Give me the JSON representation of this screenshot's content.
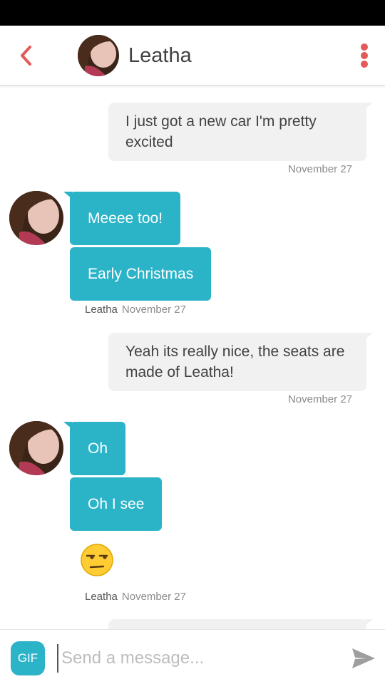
{
  "header": {
    "name": "Leatha",
    "back_icon": "chevron-left-icon",
    "menu_icon": "more-vertical-icon",
    "accent": "#e35a5a"
  },
  "messages": [
    {
      "from": "me",
      "text": "I just got a new car I'm pretty excited",
      "time": "November 27"
    },
    {
      "from": "them",
      "sender": "Leatha",
      "bubbles": [
        "Meeee too!",
        "Early Christmas"
      ],
      "time": "November 27"
    },
    {
      "from": "me",
      "text": "Yeah its really nice, the seats are made of Leatha!",
      "time": "November 27"
    },
    {
      "from": "them",
      "sender": "Leatha",
      "bubbles": [
        "Oh",
        "Oh I see"
      ],
      "emoji": "unamused-face-icon",
      "time": "November 27"
    }
  ],
  "composer": {
    "gif_label": "GIF",
    "placeholder": "Send a message...",
    "send_icon": "send-icon"
  },
  "colors": {
    "incoming_bubble": "#2bb3c8",
    "outgoing_bubble": "#f1f1f1"
  }
}
